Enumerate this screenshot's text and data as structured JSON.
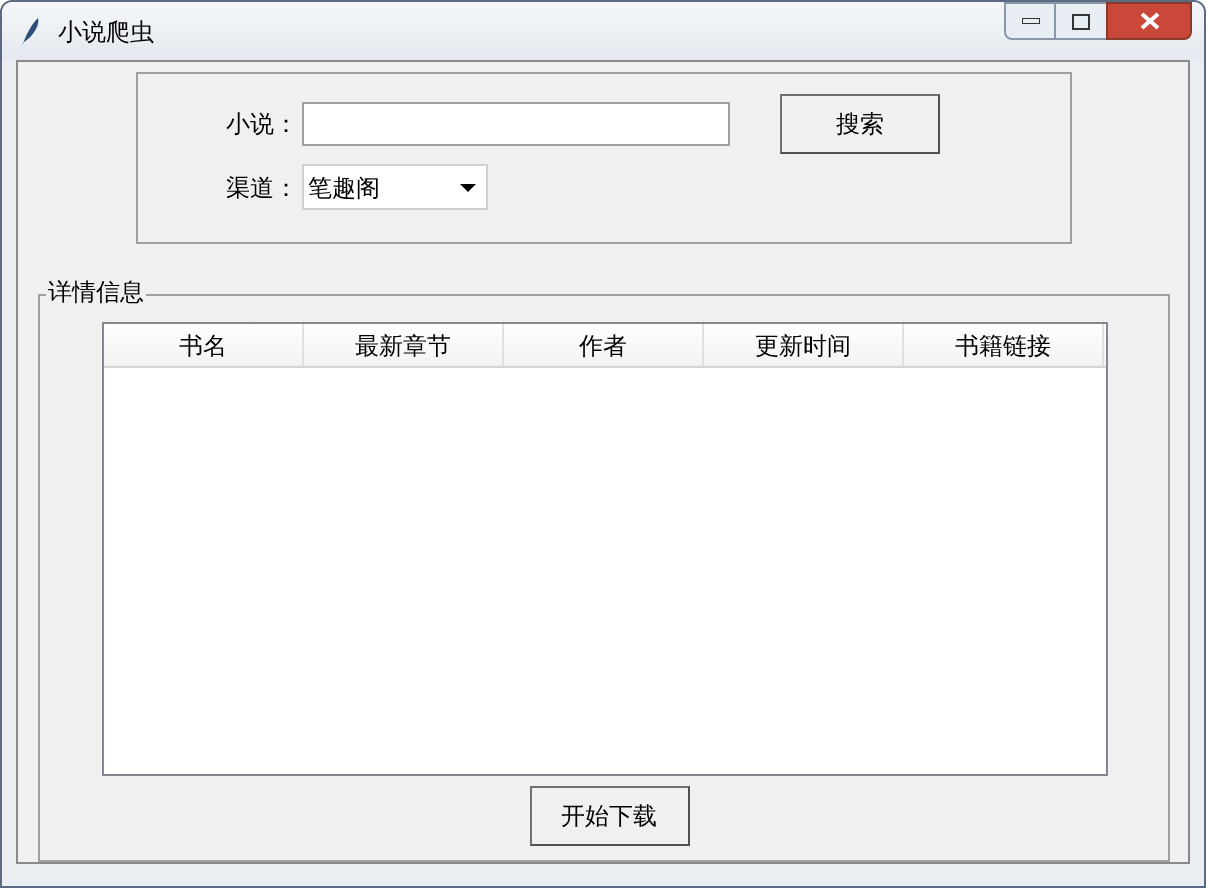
{
  "window": {
    "title": "小说爬虫"
  },
  "search": {
    "novel_label": "小说：",
    "search_button": "搜索",
    "channel_label": "渠道：",
    "channel_value": "笔趣阁"
  },
  "details": {
    "title": "详情信息",
    "table": {
      "columns": [
        "书名",
        "最新章节",
        "作者",
        "更新时间",
        "书籍链接"
      ]
    }
  },
  "download_button": "开始下载"
}
